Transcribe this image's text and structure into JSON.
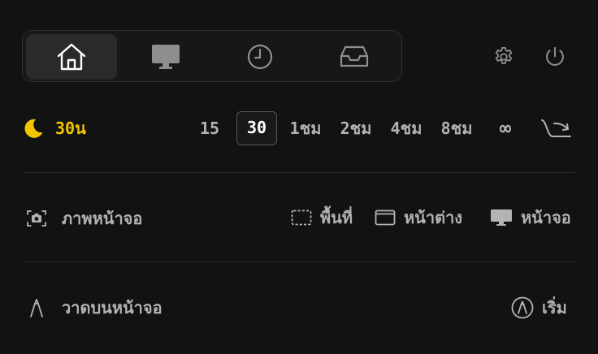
{
  "tabs": [
    {
      "icon": "home-icon",
      "active": true
    },
    {
      "icon": "monitor-icon",
      "active": false
    },
    {
      "icon": "clock-icon",
      "active": false
    },
    {
      "icon": "inbox-icon",
      "active": false
    }
  ],
  "top_icons": [
    "gear-icon",
    "power-icon"
  ],
  "timer": {
    "current_label": "30น",
    "accent_color": "#f2c500",
    "options": [
      "15",
      "30",
      "1ชม",
      "2ชม",
      "4ชม",
      "8ชม",
      "∞"
    ],
    "selected": "30"
  },
  "screenshot": {
    "label": "ภาพหน้าจอ",
    "actions": {
      "area": "พื้นที่",
      "window": "หน้าต่าง",
      "screen": "หน้าจอ"
    }
  },
  "draw": {
    "label": "วาดบนหน้าจอ",
    "start": "เริ่ม"
  }
}
